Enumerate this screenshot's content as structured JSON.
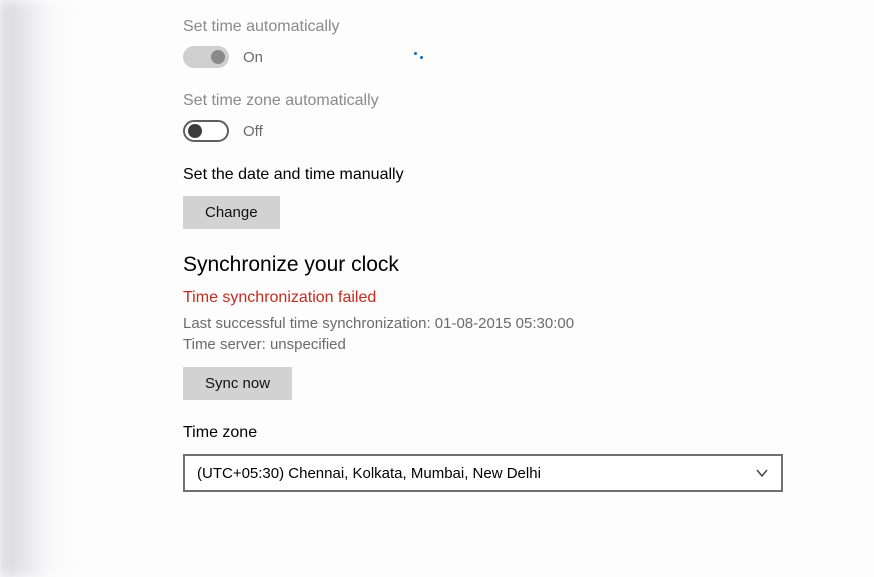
{
  "autoTime": {
    "label": "Set time automatically",
    "status": "On"
  },
  "autoZone": {
    "label": "Set time zone automatically",
    "status": "Off"
  },
  "manual": {
    "label": "Set the date and time manually",
    "button": "Change"
  },
  "sync": {
    "heading": "Synchronize your clock",
    "error": "Time synchronization failed",
    "lastSync": "Last successful time synchronization: 01-08-2015 05:30:00",
    "server": "Time server: unspecified",
    "button": "Sync now"
  },
  "timezone": {
    "label": "Time zone",
    "value": "(UTC+05:30) Chennai, Kolkata, Mumbai, New Delhi"
  }
}
